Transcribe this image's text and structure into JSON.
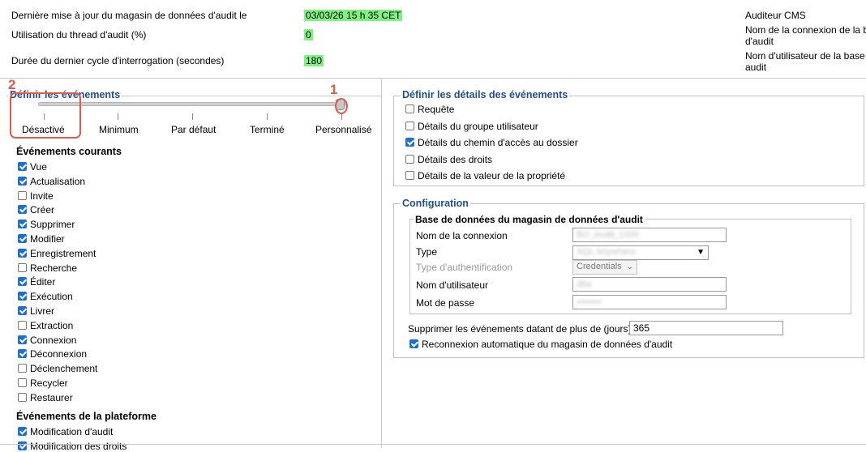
{
  "header": {
    "last_update_label": "Dernière mise à jour du magasin de données d'audit le",
    "last_update_value": "03/03/26 15 h 35 CET",
    "thread_label": "Utilisation du thread d'audit (%)",
    "thread_value": "0",
    "cycle_label": "Durée du dernier cycle d'interrogation (secondes)",
    "cycle_value": "180",
    "auditor": "Auditeur CMS",
    "conn_name_line1": "Nom de la connexion de la b",
    "conn_name_line2": "d'audit",
    "user_line1": "Nom d'utilisateur de la base",
    "user_line2": "audit"
  },
  "events": {
    "legend": "Définir les événements",
    "levels": [
      "Désactivé",
      "Minimum",
      "Par défaut",
      "Terminé",
      "Personnalisé"
    ],
    "current_title": "Événements courants",
    "current": [
      {
        "label": "Vue",
        "checked": true
      },
      {
        "label": "Actualisation",
        "checked": true
      },
      {
        "label": "Invite",
        "checked": false
      },
      {
        "label": "Créer",
        "checked": true
      },
      {
        "label": "Supprimer",
        "checked": true
      },
      {
        "label": "Modifier",
        "checked": true
      },
      {
        "label": "Enregistrement",
        "checked": true
      },
      {
        "label": "Recherche",
        "checked": false
      },
      {
        "label": "Éditer",
        "checked": true
      },
      {
        "label": "Exécution",
        "checked": true
      },
      {
        "label": "Livrer",
        "checked": true
      },
      {
        "label": "Extraction",
        "checked": false
      },
      {
        "label": "Connexion",
        "checked": true
      },
      {
        "label": "Déconnexion",
        "checked": true
      },
      {
        "label": "Déclenchement",
        "checked": false
      },
      {
        "label": "Recycler",
        "checked": false
      },
      {
        "label": "Restaurer",
        "checked": false
      }
    ],
    "platform_title": "Événements de la plateforme",
    "platform": [
      {
        "label": "Modification d'audit",
        "checked": true
      },
      {
        "label": "Modification des droits",
        "checked": true
      }
    ]
  },
  "details": {
    "legend": "Définir les détails des événements",
    "items": [
      {
        "label": "Requête",
        "checked": false
      },
      {
        "label": "Détails du groupe utilisateur",
        "checked": false
      },
      {
        "label": "Détails du chemin d'accès au dossier",
        "checked": true
      },
      {
        "label": "Détails des droits",
        "checked": false
      },
      {
        "label": "Détails de la valeur de la propriété",
        "checked": false
      }
    ]
  },
  "config": {
    "legend": "Configuration",
    "db_title": "Base de données du magasin de données d'audit",
    "conn_label": "Nom de la connexion",
    "conn_value": "BO_Audit_DSN",
    "type_label": "Type",
    "type_value": "SQL Anywhere",
    "auth_label": "Type d'authentification",
    "auth_value": "Credentials",
    "user_label": "Nom d'utilisateur",
    "user_value": "dba",
    "pwd_label": "Mot de passe",
    "pwd_value": "••••••••",
    "delete_label": "Supprimer les événements datant de plus de (jours)",
    "delete_value": "365",
    "reconnect_label": "Reconnexion automatique du magasin de données d'audit",
    "reconnect_checked": true
  },
  "annotations": {
    "marker_1": "1",
    "marker_2": "2"
  },
  "colors": {
    "highlight": "#7ef27e",
    "legend": "#1f4f8f",
    "annotation": "#e05a4a",
    "checkbox": "#1a6fd1"
  },
  "slider": {
    "selected_index": 4
  }
}
